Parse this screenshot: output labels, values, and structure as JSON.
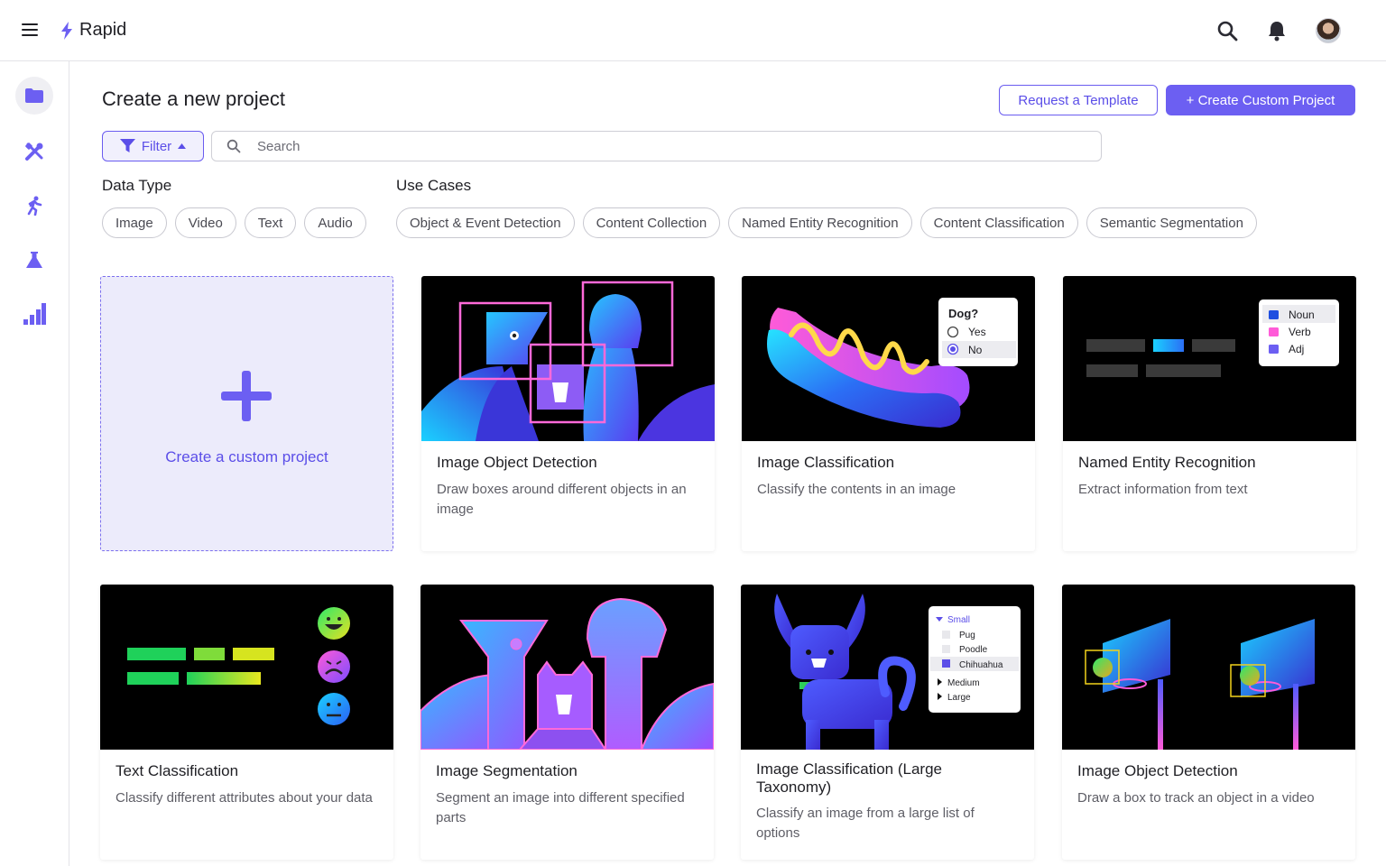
{
  "app": {
    "name": "Rapid"
  },
  "header": {
    "title": "Create a new project",
    "request_label": "Request a Template",
    "create_label": "+ Create Custom Project"
  },
  "filter": {
    "label": "Filter"
  },
  "search": {
    "placeholder": "Search",
    "value": ""
  },
  "data_type": {
    "label": "Data Type",
    "options": [
      "Image",
      "Video",
      "Text",
      "Audio"
    ]
  },
  "use_cases": {
    "label": "Use Cases",
    "options": [
      "Object & Event Detection",
      "Content Collection",
      "Named Entity Recognition",
      "Content Classification",
      "Semantic Segmentation"
    ]
  },
  "create_card": {
    "label": "Create a custom project"
  },
  "cards": [
    {
      "title": "Image Object Detection",
      "description": "Draw boxes around different objects in an image"
    },
    {
      "title": "Image Classification",
      "description": "Classify the contents in an image",
      "widget": {
        "question": "Dog?",
        "options": [
          "Yes",
          "No"
        ],
        "selected": "No"
      }
    },
    {
      "title": "Named Entity Recognition",
      "description": "Extract information from text",
      "legend": [
        "Noun",
        "Verb",
        "Adj"
      ]
    },
    {
      "title": "Text Classification",
      "description": "Classify different attributes about your data"
    },
    {
      "title": "Image Segmentation",
      "description": "Segment an image into different specified parts"
    },
    {
      "title": "Image Classification (Large Taxonomy)",
      "description": "Classify an image from a large list of options",
      "tree": {
        "root": "Small",
        "children": [
          "Pug",
          "Poodle",
          "Chihuahua"
        ],
        "others": [
          "Medium",
          "Large"
        ]
      }
    },
    {
      "title": "Image Object Detection",
      "description": "Draw a box to track an object in a video"
    }
  ],
  "colors": {
    "accent": "#6c5ff2",
    "accent_text": "#5b4ee8",
    "create_bg": "#ecebfb"
  },
  "icons": [
    "menu-icon",
    "bolt-icon",
    "search-icon",
    "bell-icon",
    "folder-icon",
    "tools-icon",
    "runner-icon",
    "flask-icon",
    "bar-chart-icon",
    "filter-icon",
    "caret-up-icon",
    "plus-icon"
  ]
}
